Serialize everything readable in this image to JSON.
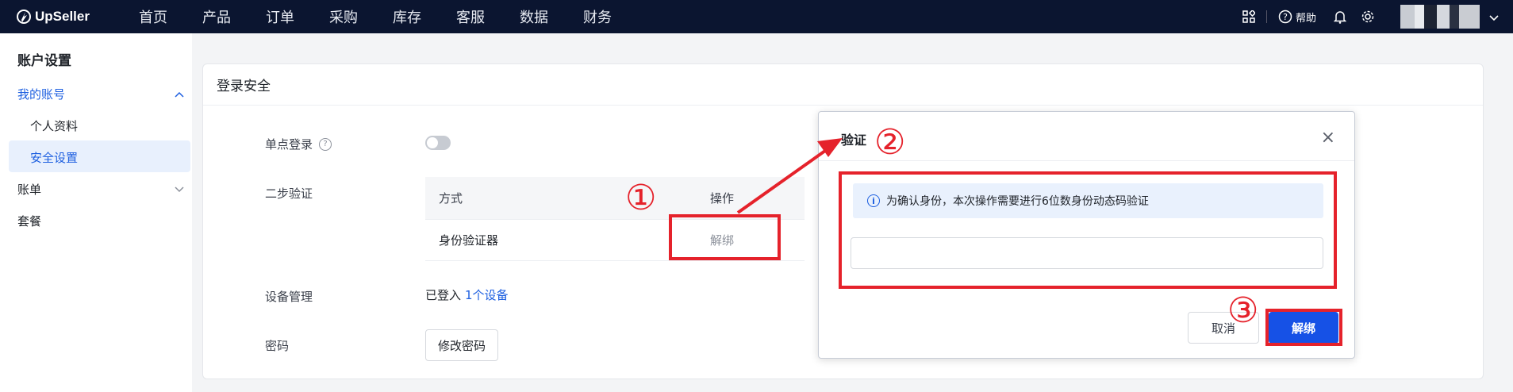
{
  "topbar": {
    "logo_text": "UpSeller",
    "nav": [
      "首页",
      "产品",
      "订单",
      "采购",
      "库存",
      "客服",
      "数据",
      "财务"
    ],
    "help_label": "帮助"
  },
  "sidebar": {
    "title": "账户设置",
    "my_account": "我的账号",
    "profile": "个人资料",
    "security": "安全设置",
    "billing": "账单",
    "plan": "套餐"
  },
  "main": {
    "card_title": "登录安全",
    "sso_label": "单点登录",
    "two_step_label": "二步验证",
    "table_headers": [
      "方式",
      "操作"
    ],
    "table_rows": [
      {
        "method": "身份验证器",
        "action": "解绑"
      }
    ],
    "device_label": "设备管理",
    "device_text": "已登入",
    "device_link": "1个设备",
    "password_label": "密码",
    "change_password": "修改密码",
    "sso_enabled": false
  },
  "modal": {
    "title": "验证",
    "close": "×",
    "info_text": "为确认身份，本次操作需要进行6位数身份动态码验证",
    "input_value": "",
    "input_placeholder": "",
    "cancel": "取消",
    "confirm": "解绑"
  },
  "annotations": {
    "step1": "①",
    "step2": "②",
    "step3": "③",
    "color": "#e5222b"
  },
  "colors": {
    "topbar_bg": "#0b1530",
    "accent": "#1d5fe0",
    "primary_button": "#1651e6"
  }
}
